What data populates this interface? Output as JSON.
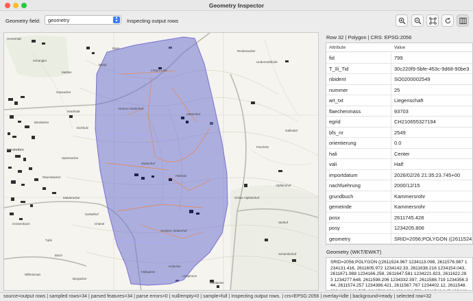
{
  "window": {
    "title": "Geometry Inspector",
    "controls": [
      "#ff5f57",
      "#febc2e",
      "#28c840"
    ]
  },
  "toolbar": {
    "field_label": "Geometry field:",
    "field_value": "geometry",
    "status": "Inspecting output rows",
    "buttons": [
      "zoom-in-icon",
      "zoom-out-icon",
      "zoom-extent-icon",
      "refresh-icon",
      "panel-toggle-icon"
    ]
  },
  "map": {
    "labels": [
      "Grossmatt",
      "Schüngler",
      "Mettlen",
      "Bärgli",
      "Gassacker",
      "Hardmatt",
      "Bündacker",
      "Eichholz",
      "Spiessacker",
      "Vorstetten",
      "Räumelacker",
      "Malderacker",
      "Gerbelhof",
      "Tubli",
      "Bisch",
      "Gretzenbach",
      "Chänel",
      "Riffertsmatt",
      "Burgacker",
      "Bann",
      "Reckenacher",
      "Undermühlhofe",
      "Gälhubel",
      "Feechrüt",
      "Alpfelenhof",
      "Chline Alpfelenhof",
      "Steihof",
      "Schümlenhof",
      "Hinterer Mattenhof",
      "Long o Lani",
      "Mettenhof",
      "Mattenhof",
      "Vorderer Mattenhof",
      "Feldrain",
      "Hofacker",
      "Müligasse",
      "Langmoos",
      "Mühlacker"
    ],
    "polygon_fill": "#6f74d0",
    "polygon_stroke": "#7a6fd0"
  },
  "panel": {
    "row_header": "Row 32 | Polygon | CRS: EPSG:2056",
    "columns": [
      "Attribute",
      "Value"
    ],
    "rows": [
      {
        "attr": "fid",
        "val": "799"
      },
      {
        "attr": "T_Ili_Tid",
        "val": "30c220f9-5bfe-453c-9d68-90be3"
      },
      {
        "attr": "nbident",
        "val": "SO0200002549"
      },
      {
        "attr": "nummer",
        "val": "25"
      },
      {
        "attr": "art_txt",
        "val": "Liegenschaft"
      },
      {
        "attr": "flaechenmass",
        "val": "93703"
      },
      {
        "attr": "egrid",
        "val": "CH210655327194"
      },
      {
        "attr": "bfs_nr",
        "val": "2549"
      },
      {
        "attr": "orientierung",
        "val": "0.0"
      },
      {
        "attr": "hali",
        "val": "Center"
      },
      {
        "attr": "vali",
        "val": "Half"
      },
      {
        "attr": "importdatum",
        "val": "2026/02/26 21:35:23.745+00"
      },
      {
        "attr": "nachfuehrung",
        "val": "2000/12/15"
      },
      {
        "attr": "grundbuch",
        "val": "Kammersrohr"
      },
      {
        "attr": "gemeinde",
        "val": "Kammersrohr"
      },
      {
        "attr": "posx",
        "val": "2611745.428"
      },
      {
        "attr": "posy",
        "val": "1234205.806"
      },
      {
        "attr": "geometry",
        "val": "SRID=2056;POLYGON ((2611524.9"
      }
    ],
    "wkt_label": "Geometry (WKT/EWKT)",
    "wkt_text": "SRID=2056;POLYGON ((2611524.967 1234113.098, 2611576.987 1234131.416, 2611605.972 1234142.33, 2611638.216 1234154.043, 2611671.988 1234166.258, 2611647.581 1234221.823, 2611622.283 1234277.648, 2611598.206 1234332.397, 2611588.719 1234356.344, 2611574.257 1234386.421, 2611567.767 1234402.12, 2611548.832 1234442.507, 2611529.831 1234484.553, 2611542.845 1234486.137, 2611586.603 1234491.464, 2611629.681 1234496.609, 2611631.479 1234494.259, 2611666.805 1234442.065, 2611696.899 1234406.924, 2611711.121 1234380.336, 2611730.377 1234357.786,"
  },
  "statusbar": {
    "text": "source=output rows | sampled rows=34 | parsed features=34 | parse errors=0 | null/empty=0 | sample=full | Inspecting output rows. | crs=EPSG:2056 | overlay=idle | background=ready | selected row=32"
  }
}
